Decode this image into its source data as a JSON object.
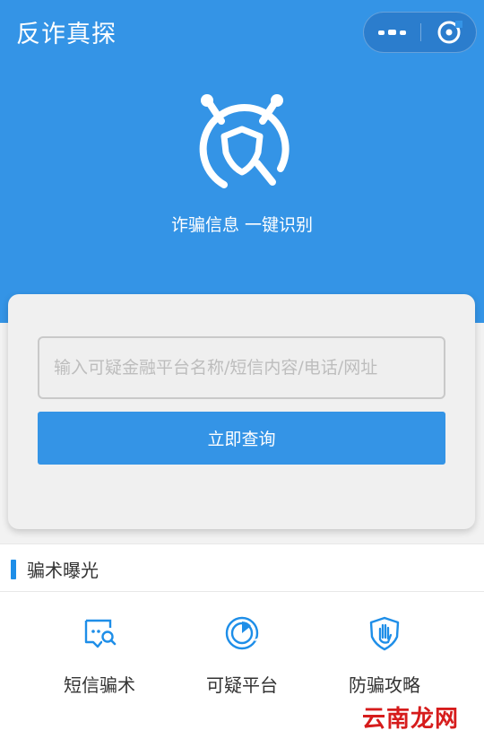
{
  "header": {
    "title": "反诈真探",
    "more_icon": "more-dots-icon",
    "close_icon": "close-target-icon"
  },
  "hero": {
    "logo_icon": "shield-search-robot-icon",
    "slogan": "诈骗信息 一键识别",
    "background": "#3494e6"
  },
  "search": {
    "placeholder": "输入可疑金融平台名称/短信内容/电话/网址",
    "button_label": "立即查询"
  },
  "exposure": {
    "title": "骗术曝光",
    "items": [
      {
        "label": "短信骗术",
        "icon": "sms-search-icon"
      },
      {
        "label": "可疑平台",
        "icon": "platform-gauge-icon"
      },
      {
        "label": "防骗攻略",
        "icon": "shield-hand-icon"
      }
    ]
  },
  "watermark": "云南龙网",
  "colors": {
    "accent": "#3494e6",
    "icon_blue": "#1e8ee8",
    "watermark_red": "#d61c1c"
  }
}
